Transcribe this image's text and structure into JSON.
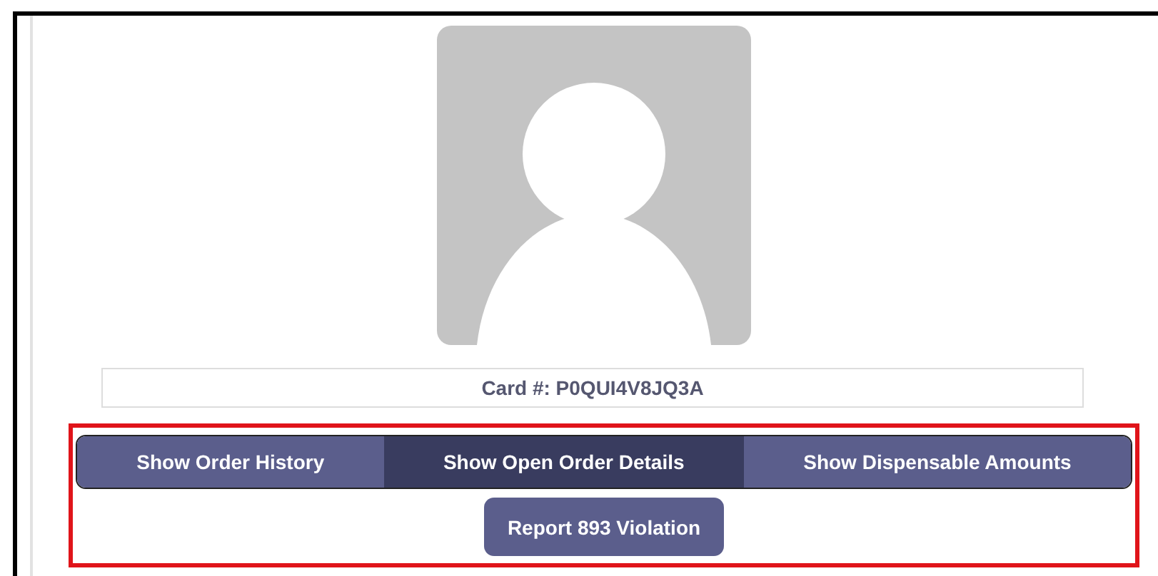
{
  "card": {
    "label": "Card #: P0QUI4V8JQ3A"
  },
  "tabs": [
    {
      "label": "Show Order History",
      "selected": false
    },
    {
      "label": "Show Open Order Details",
      "selected": true
    },
    {
      "label": "Show Dispensable Amounts",
      "selected": false
    }
  ],
  "action_button": {
    "label": "Report 893 Violation"
  }
}
